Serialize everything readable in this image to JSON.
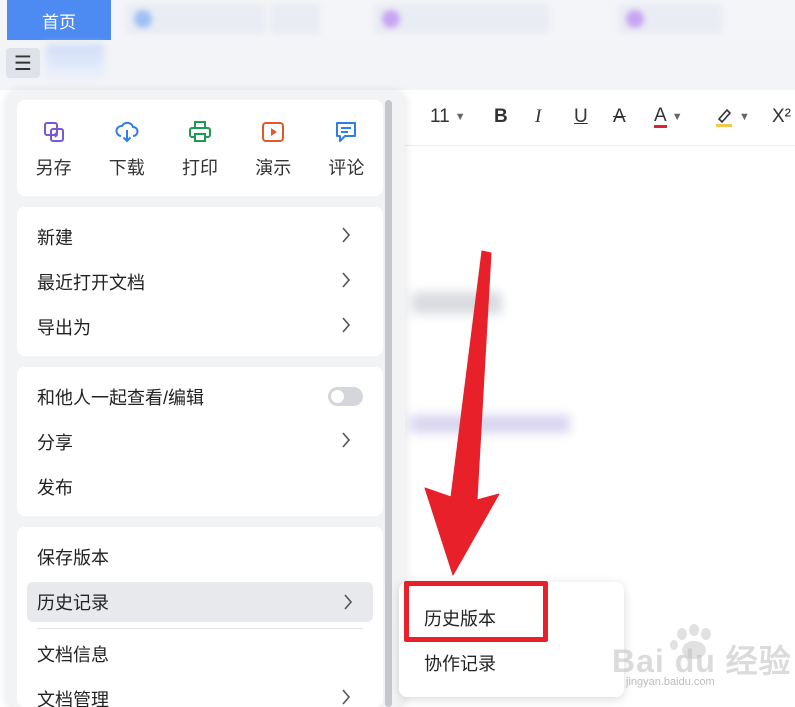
{
  "tabs": {
    "home": "首页"
  },
  "toolbar": {
    "font_size": "11",
    "bold": "B",
    "italic": "I",
    "underline": "U",
    "strike": "A",
    "font_color": "A",
    "superscript": "X²"
  },
  "quick_actions": [
    {
      "label": "另存",
      "icon": "save-as-icon",
      "color": "#7b57d6"
    },
    {
      "label": "下载",
      "icon": "download-icon",
      "color": "#2f7ee8"
    },
    {
      "label": "打印",
      "icon": "print-icon",
      "color": "#1f9a55"
    },
    {
      "label": "演示",
      "icon": "present-icon",
      "color": "#e0592a"
    },
    {
      "label": "评论",
      "icon": "comment-icon",
      "color": "#2f7ee8"
    }
  ],
  "menu": {
    "new": "新建",
    "recent": "最近打开文档",
    "export": "导出为",
    "coedit": "和他人一起查看/编辑",
    "share": "分享",
    "publish": "发布",
    "save_version": "保存版本",
    "history": "历史记录",
    "doc_info": "文档信息",
    "doc_manage": "文档管理"
  },
  "submenu": {
    "history_version": "历史版本",
    "collab_record": "协作记录"
  },
  "watermark": {
    "brand": "Bai du 经验",
    "url": "jingyan.baidu.com"
  },
  "colors": {
    "accent": "#4d8bf2",
    "annotation_red": "#e8202a",
    "font_color_bar": "#d9252b",
    "highlight_bar": "#f2c94c"
  }
}
